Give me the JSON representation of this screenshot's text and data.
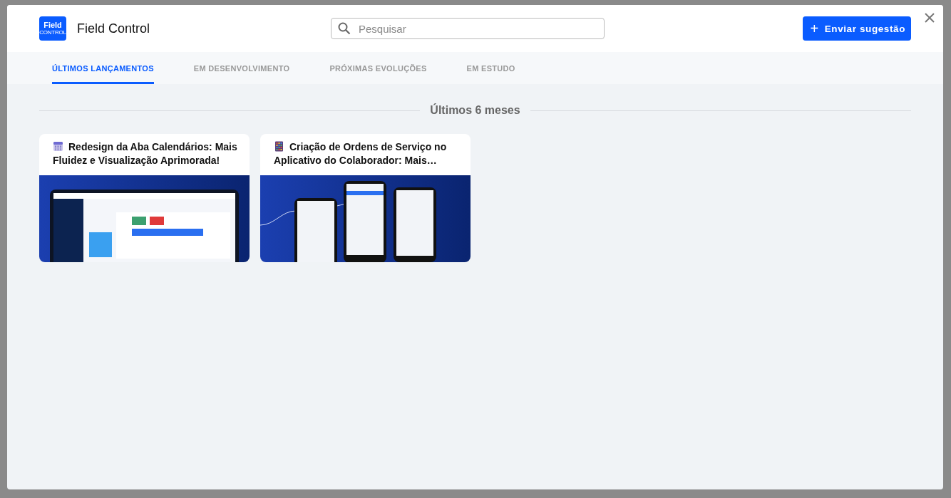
{
  "header": {
    "logo": {
      "word": "Field",
      "tagline": "CONTROL"
    },
    "title": "Field Control",
    "search": {
      "placeholder": "Pesquisar"
    },
    "action_button": {
      "icon": "+",
      "label": "Enviar sugestão"
    }
  },
  "tabs": [
    {
      "label": "ÚLTIMOS LANÇAMENTOS",
      "selected": true
    },
    {
      "label": "EM DESENVOLVIMENTO",
      "selected": false
    },
    {
      "label": "PRÓXIMAS EVOLUÇÕES",
      "selected": false
    },
    {
      "label": "EM ESTUDO",
      "selected": false
    }
  ],
  "section_title": "Últimos 6 meses",
  "cards": [
    {
      "kind": "calendar",
      "title": "Redesign da Aba Calendários: Mais Fluidez e Visualização Aprimorada!"
    },
    {
      "kind": "abacus",
      "title": "Criação de Ordens de Serviço no Aplicativo do Colaborador: Mais…"
    }
  ]
}
